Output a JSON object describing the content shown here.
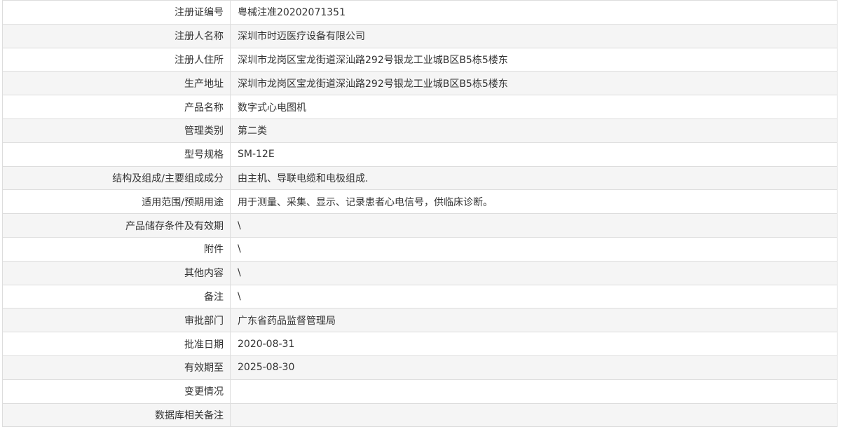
{
  "record": {
    "rows": [
      {
        "label": "注册证编号",
        "value": "粤械注准20202071351"
      },
      {
        "label": "注册人名称",
        "value": "深圳市时迈医疗设备有限公司"
      },
      {
        "label": "注册人住所",
        "value": "深圳市龙岗区宝龙街道深汕路292号银龙工业城B区B5栋5楼东"
      },
      {
        "label": "生产地址",
        "value": "深圳市龙岗区宝龙街道深汕路292号银龙工业城B区B5栋5楼东"
      },
      {
        "label": "产品名称",
        "value": "数字式心电图机"
      },
      {
        "label": "管理类别",
        "value": "第二类"
      },
      {
        "label": "型号规格",
        "value": "SM-12E"
      },
      {
        "label": "结构及组成/主要组成成分",
        "value": "由主机、导联电缆和电极组成."
      },
      {
        "label": "适用范围/预期用途",
        "value": "用于测量、采集、显示、记录患者心电信号，供临床诊断。"
      },
      {
        "label": "产品储存条件及有效期",
        "value": "\\"
      },
      {
        "label": "附件",
        "value": "\\"
      },
      {
        "label": "其他内容",
        "value": "\\"
      },
      {
        "label": "备注",
        "value": "\\"
      },
      {
        "label": "审批部门",
        "value": "广东省药品监督管理局"
      },
      {
        "label": "批准日期",
        "value": "2020-08-31"
      },
      {
        "label": "有效期至",
        "value": "2025-08-30"
      },
      {
        "label": "变更情况",
        "value": ""
      },
      {
        "label": "数据库相关备注",
        "value": ""
      }
    ]
  }
}
